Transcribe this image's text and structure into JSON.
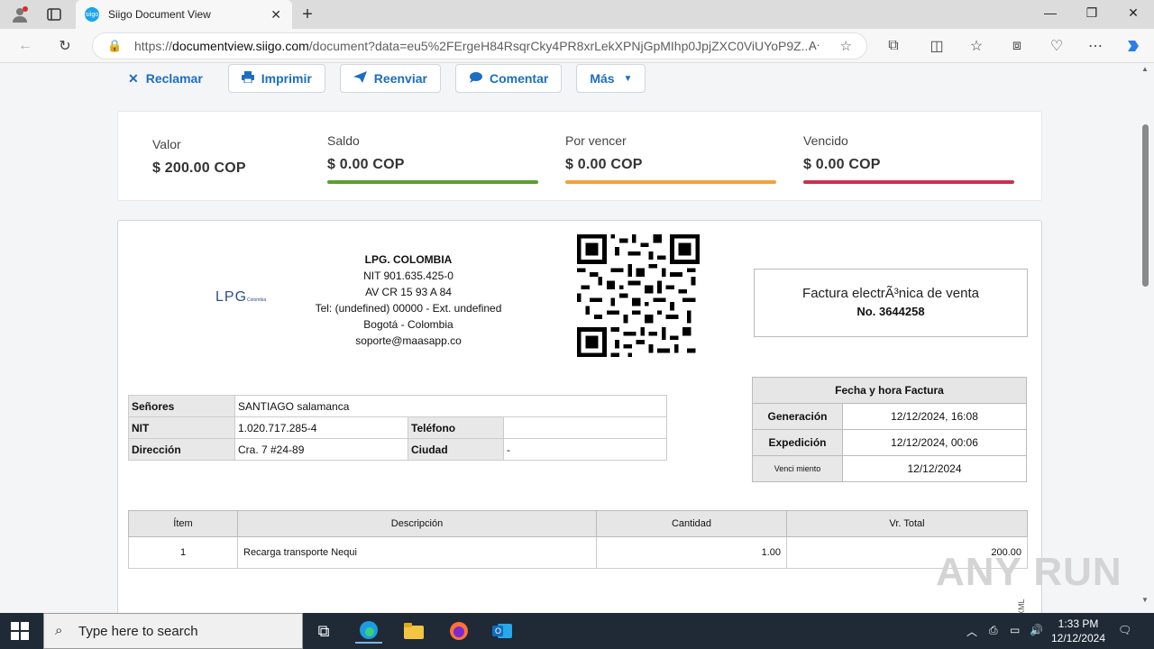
{
  "browser": {
    "tab_title": "Siigo Document View",
    "tab_favicon": "siigo",
    "url_prefix": "https://",
    "url_domain": "documentview.siigo.com",
    "url_rest": "/document?data=eu5%2FErgeH84RsqrCky4PR8xrLekXPNjGpMIhp0JpjZXC0ViUYoP9Z..."
  },
  "actions": [
    {
      "label": "Reclamar",
      "icon": "x-icon"
    },
    {
      "label": "Imprimir",
      "icon": "printer-icon"
    },
    {
      "label": "Reenviar",
      "icon": "send-icon"
    },
    {
      "label": "Comentar",
      "icon": "comment-icon"
    },
    {
      "label": "Más",
      "icon": "chevron-down-icon"
    }
  ],
  "summary": [
    {
      "label": "Valor",
      "value": "$ 200.00 COP",
      "bar_color": ""
    },
    {
      "label": "Saldo",
      "value": "$ 0.00 COP",
      "bar_color": "#5a9e2f"
    },
    {
      "label": "Por vencer",
      "value": "$ 0.00 COP",
      "bar_color": "#f2a23a"
    },
    {
      "label": "Vencido",
      "value": "$ 0.00 COP",
      "bar_color": "#c8324f"
    }
  ],
  "company": {
    "logo_text": "LPG",
    "logo_sub": "Colombia",
    "name": "LPG. COLOMBIA",
    "nit": "NIT 901.635.425-0",
    "address": "AV CR 15 93 A 84",
    "phone": "Tel: (undefined) 00000 - Ext. undefined",
    "city": "Bogotá - Colombia",
    "email": "soporte@maasapp.co"
  },
  "invoice": {
    "title": "Factura electrÃ³nica de venta",
    "number": "No. 3644258"
  },
  "customer": {
    "senores_label": "Señores",
    "senores": "SANTIAGO salamanca",
    "nit_label": "NIT",
    "nit": "1.020.717.285-4",
    "telefono_label": "Teléfono",
    "telefono": "",
    "direccion_label": "Dirección",
    "direccion": "Cra. 7 #24-89",
    "ciudad_label": "Ciudad",
    "ciudad": "-"
  },
  "dates": {
    "header": "Fecha y hora Factura",
    "rows": [
      {
        "label": "Generación",
        "value": "12/12/2024, 16:08"
      },
      {
        "label": "Expedición",
        "value": "12/12/2024, 00:06"
      },
      {
        "label": "Venci miento",
        "value": "12/12/2024"
      }
    ]
  },
  "items": {
    "headers": [
      "Ítem",
      "Descripción",
      "Cantidad",
      "Vr. Total"
    ],
    "rows": [
      {
        "item": "1",
        "descripcion": "Recarga transporte Nequi",
        "cantidad": "1.00",
        "total": "200.00"
      }
    ]
  },
  "side_text": "ver en el XML",
  "watermark": "ANY RUN",
  "taskbar": {
    "search_placeholder": "Type here to search",
    "time": "1:33 PM",
    "date": "12/12/2024"
  },
  "colors": {
    "accent": "#1b6ec2",
    "taskbar": "#1f2a36"
  }
}
